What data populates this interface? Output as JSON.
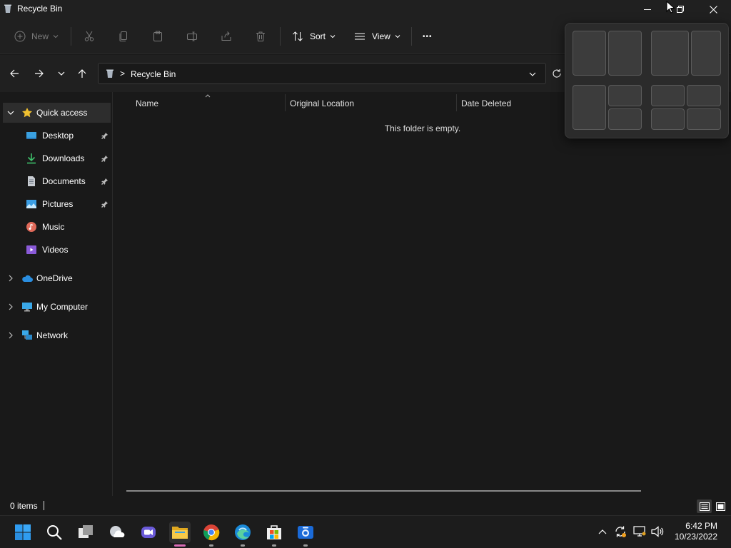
{
  "window": {
    "title": "Recycle Bin"
  },
  "toolbar": {
    "new_label": "New",
    "sort_label": "Sort",
    "view_label": "View",
    "more_label": "•••"
  },
  "address": {
    "crumb_separator": ">",
    "location": "Recycle Bin"
  },
  "sidebar": {
    "quick_access": "Quick access",
    "items": [
      {
        "label": "Desktop",
        "icon": "desktop-icon",
        "pinned": true
      },
      {
        "label": "Downloads",
        "icon": "download-icon",
        "pinned": true
      },
      {
        "label": "Documents",
        "icon": "document-icon",
        "pinned": true
      },
      {
        "label": "Pictures",
        "icon": "pictures-icon",
        "pinned": true
      },
      {
        "label": "Music",
        "icon": "music-icon",
        "pinned": false
      },
      {
        "label": "Videos",
        "icon": "videos-icon",
        "pinned": false
      }
    ],
    "roots": [
      {
        "label": "OneDrive",
        "icon": "cloud-icon"
      },
      {
        "label": "My Computer",
        "icon": "computer-icon"
      },
      {
        "label": "Network",
        "icon": "network-icon"
      }
    ]
  },
  "columns": [
    "Name",
    "Original Location",
    "Date Deleted"
  ],
  "content": {
    "empty_message": "This folder is empty."
  },
  "status": {
    "item_count": "0 items"
  },
  "taskbar": {
    "pinned": [
      "start",
      "search",
      "task-view",
      "widgets",
      "teams-chat",
      "file-explorer",
      "chrome",
      "edge",
      "store",
      "camera"
    ],
    "active": "file-explorer",
    "time": "6:42 PM",
    "date": "10/23/2022"
  },
  "colors": {
    "accent": "#f0c030",
    "background": "#191919",
    "chrome_bg": "#202020",
    "active_indicator": "#d96bb5"
  }
}
